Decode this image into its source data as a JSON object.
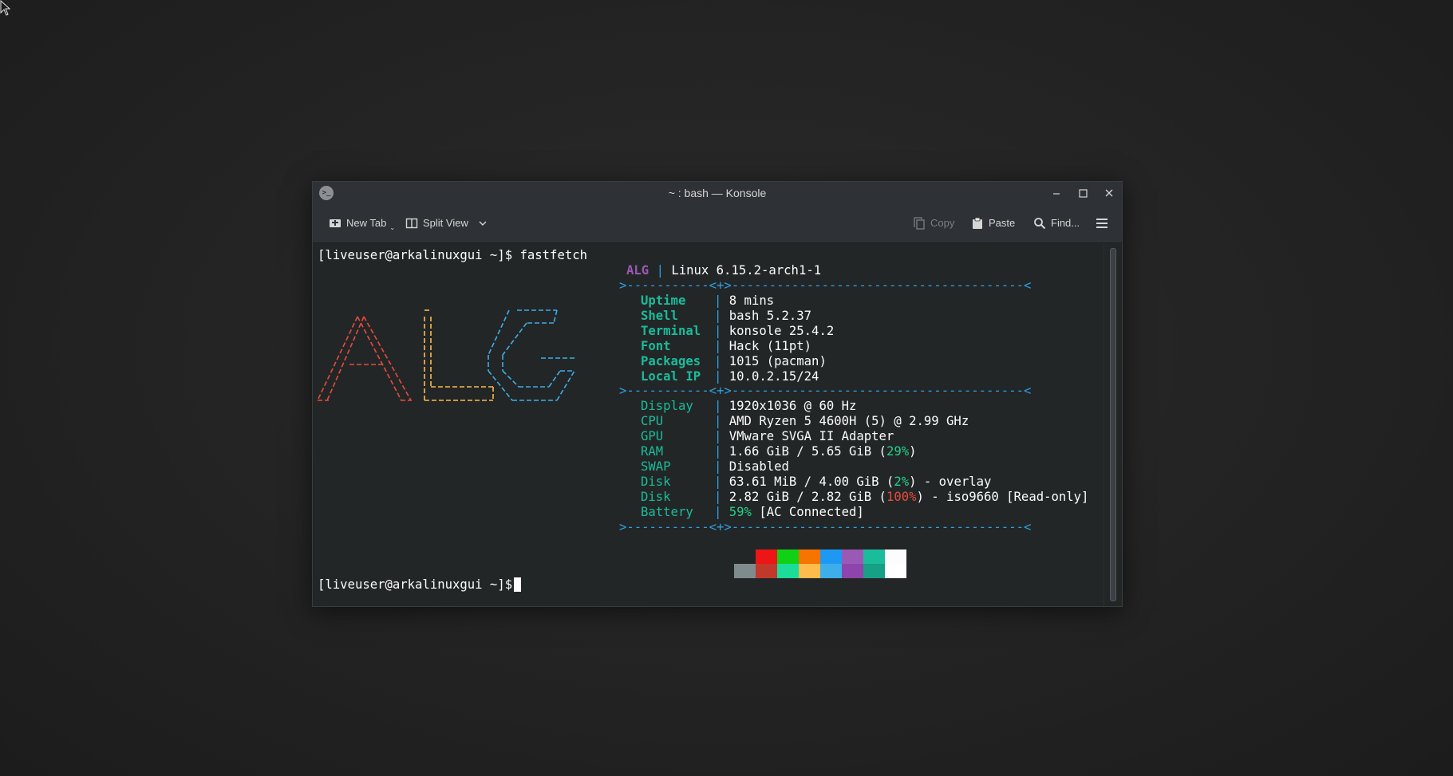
{
  "window": {
    "title": "~ : bash — Konsole",
    "app_icon": ">_"
  },
  "toolbar": {
    "new_tab": "New Tab",
    "split_view": "Split View",
    "copy": "Copy",
    "paste": "Paste",
    "find": "Find..."
  },
  "terminal": {
    "prompt": "[liveuser@arkalinuxgui ~]$",
    "command": "fastfetch",
    "logo": [
      "           _               ___",
      "    /\\    | |            /  __/",
      "   /  \\   | |           / /",
      "  / /\\ \\  | |          | |   ___",
      " / /__\\ \\ | |          | |    \\ \\",
      "/ /    \\ \\| |____       \\ \\___/ /",
      "/_/      \\_\\|_____/       \\_____/"
    ],
    "header": {
      "distro_short": "ALG",
      "pipe": "|",
      "kernel": "Linux 6.15.2-arch1-1"
    },
    "divider": ">-----------<+>---------------------------------------<",
    "group1": [
      {
        "key": "Uptime",
        "value": "8 mins"
      },
      {
        "key": "Shell",
        "value": "bash 5.2.37"
      },
      {
        "key": "Terminal",
        "value": "konsole 25.4.2"
      },
      {
        "key": "Font",
        "value": "Hack (11pt)"
      },
      {
        "key": "Packages",
        "value": "1015 (pacman)"
      },
      {
        "key": "Local IP",
        "value": "10.0.2.15/24"
      }
    ],
    "group2": {
      "display": {
        "key": "Display",
        "value": "1920x1036 @ 60 Hz"
      },
      "cpu": {
        "key": "CPU",
        "value": "AMD Ryzen 5 4600H (5) @ 2.99 GHz"
      },
      "gpu": {
        "key": "GPU",
        "value": "VMware SVGA II Adapter"
      },
      "ram": {
        "key": "RAM",
        "pre": "1.66 GiB / 5.65 GiB (",
        "pct": "29%",
        "post": ")"
      },
      "swap": {
        "key": "SWAP",
        "value": "Disabled"
      },
      "disk1": {
        "key": "Disk",
        "pre": "63.61 MiB / 4.00 GiB (",
        "pct": "2%",
        "post": ") - overlay"
      },
      "disk2": {
        "key": "Disk",
        "pre": "2.82 GiB / 2.82 GiB (",
        "pct": "100%",
        "post": ") - iso9660 [Read-only]"
      },
      "battery": {
        "key": "Battery",
        "pct": "59%",
        "post": " [AC Connected]"
      }
    },
    "colors_top": [
      "#232627",
      "#ed1515",
      "#11d116",
      "#f67400",
      "#1d99f3",
      "#9b59b6",
      "#1abc9c",
      "#fcfcfc"
    ],
    "colors_bottom": [
      "#7f8c8d",
      "#c0392b",
      "#1cdc9a",
      "#fdbc4b",
      "#3daee9",
      "#8e44ad",
      "#16a085",
      "#ffffff"
    ]
  }
}
